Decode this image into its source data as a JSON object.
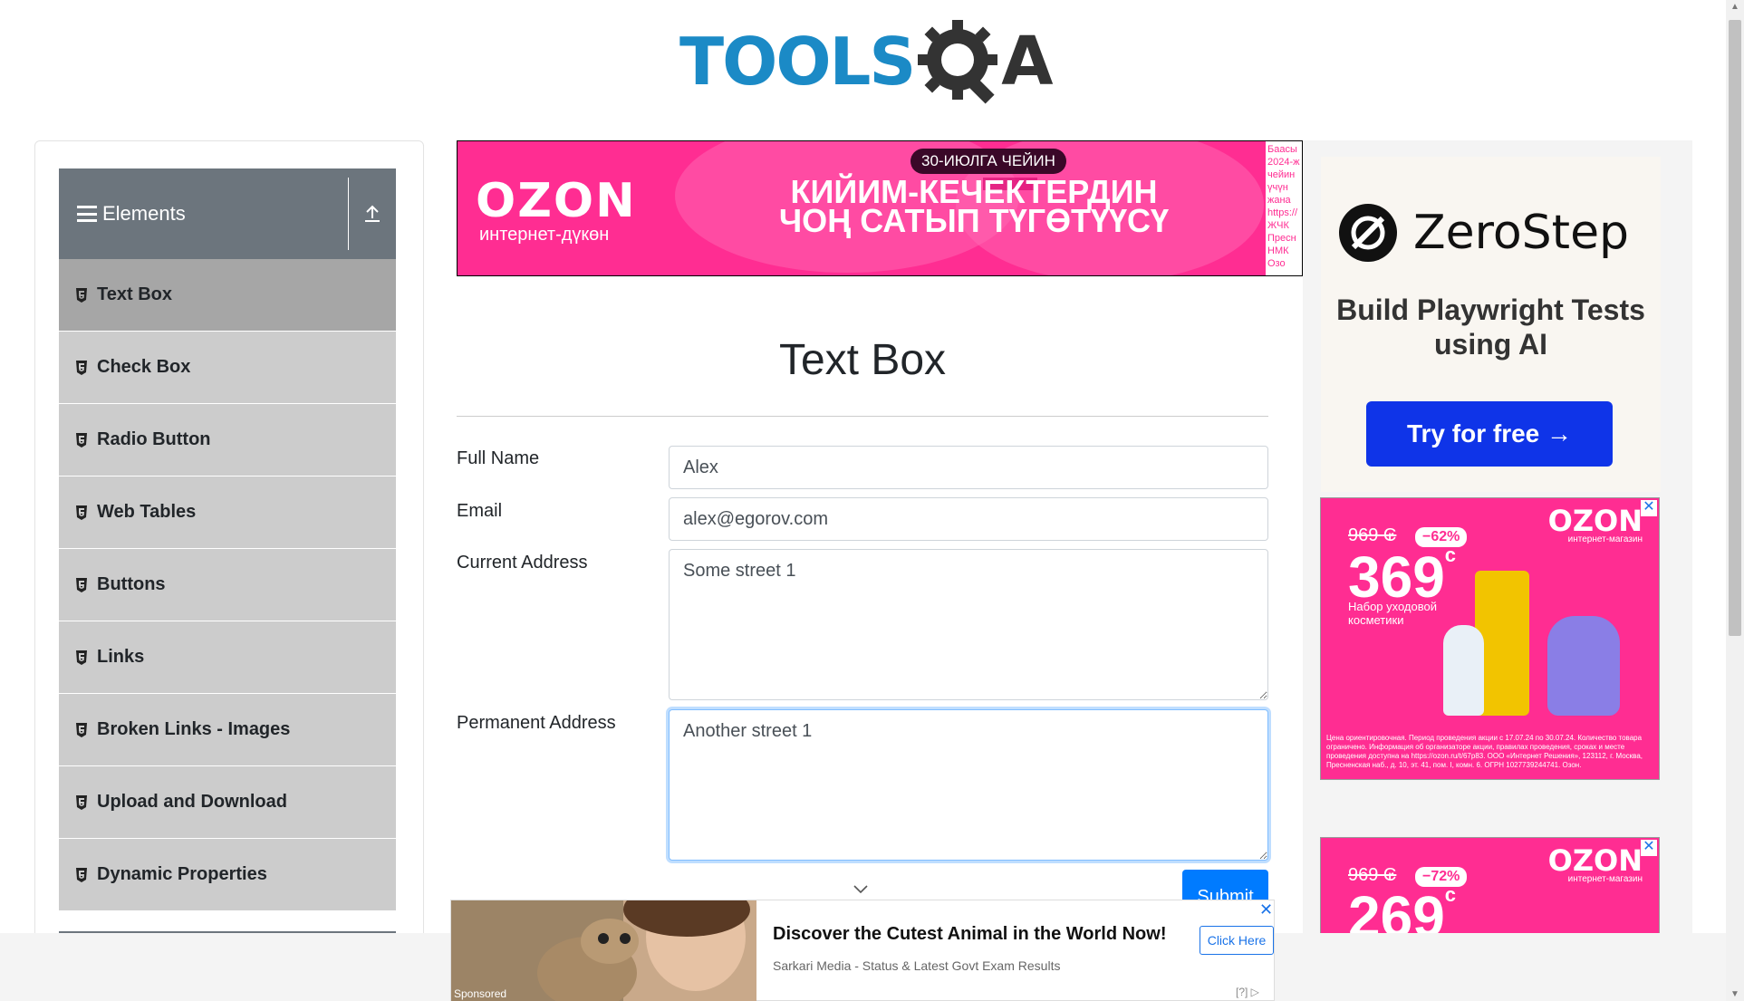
{
  "header": {
    "logo_text": "TOOLS",
    "logo_suffix": "A"
  },
  "sidebar": {
    "group_title": "Elements",
    "items": [
      {
        "label": "Text Box",
        "active": true
      },
      {
        "label": "Check Box",
        "active": false
      },
      {
        "label": "Radio Button",
        "active": false
      },
      {
        "label": "Web Tables",
        "active": false
      },
      {
        "label": "Buttons",
        "active": false
      },
      {
        "label": "Links",
        "active": false
      },
      {
        "label": "Broken Links - Images",
        "active": false
      },
      {
        "label": "Upload and Download",
        "active": false
      },
      {
        "label": "Dynamic Properties",
        "active": false
      }
    ]
  },
  "top_ad": {
    "brand": "OZON",
    "brand_sub": "интернет-дүкөн",
    "badge": "30-ИЮЛГА ЧЕЙИН",
    "headline": "КИЙИМ-КЕЧЕКТЕРДИН ЧОҢ САТЫП ТҮГӨТҮҮСҮ",
    "side_text": "Баасы 2024-ж чейин үчүн жана https:// ЖЧК Пресн НМК Озо"
  },
  "main": {
    "title": "Text Box",
    "full_name_label": "Full Name",
    "full_name_value": "Alex",
    "email_label": "Email",
    "email_value": "alex@egorov.com",
    "current_address_label": "Current Address",
    "current_address_value": "Some street 1",
    "permanent_address_label": "Permanent Address",
    "permanent_address_value": "Another street 1",
    "submit_label": "Submit"
  },
  "right_ad": {
    "brand": "ZeroStep",
    "tagline": "Build Playwright Tests using AI",
    "cta": "Try for free →"
  },
  "promo_1": {
    "old_price": "969 ₢",
    "discount": "−62%",
    "price": "369",
    "currency": "c",
    "brand": "OZON",
    "brand_sub": "интернет-магазин",
    "description": "Набор уходовой косметики",
    "fine_print": "Цена ориентировочная. Период проведения акции с 17.07.24 по 30.07.24. Количество товара ограничено. Информация об организаторе акции, правилах проведения, сроках и месте проведения доступна на https://ozon.ru/t/67p83. ООО «Интернет Решения», 123112, г. Москва, Пресненская наб., д. 10, эт. 41, пом. I, комн. 6. ОГРН 1027739244741. Озон."
  },
  "promo_2": {
    "old_price": "969 ₢",
    "discount": "−72%",
    "price": "269",
    "currency": "c",
    "brand": "OZON",
    "brand_sub": "интернет-магазин"
  },
  "bottom_ad": {
    "sponsored": "Sponsored",
    "title": "Discover the Cutest Animal in the World Now!",
    "source": "Sarkari Media - Status & Latest Govt Exam Results",
    "cta": "Click Here",
    "info": "[?]"
  },
  "colors": {
    "brand_blue": "#1b8ac6",
    "sidebar_header": "#6c757d",
    "menu_item": "#cccccc",
    "menu_active": "#a6a6a6",
    "submit": "#007bff",
    "ozon_pink": "#ff2d92",
    "zerostep_button": "#0f34e8"
  }
}
